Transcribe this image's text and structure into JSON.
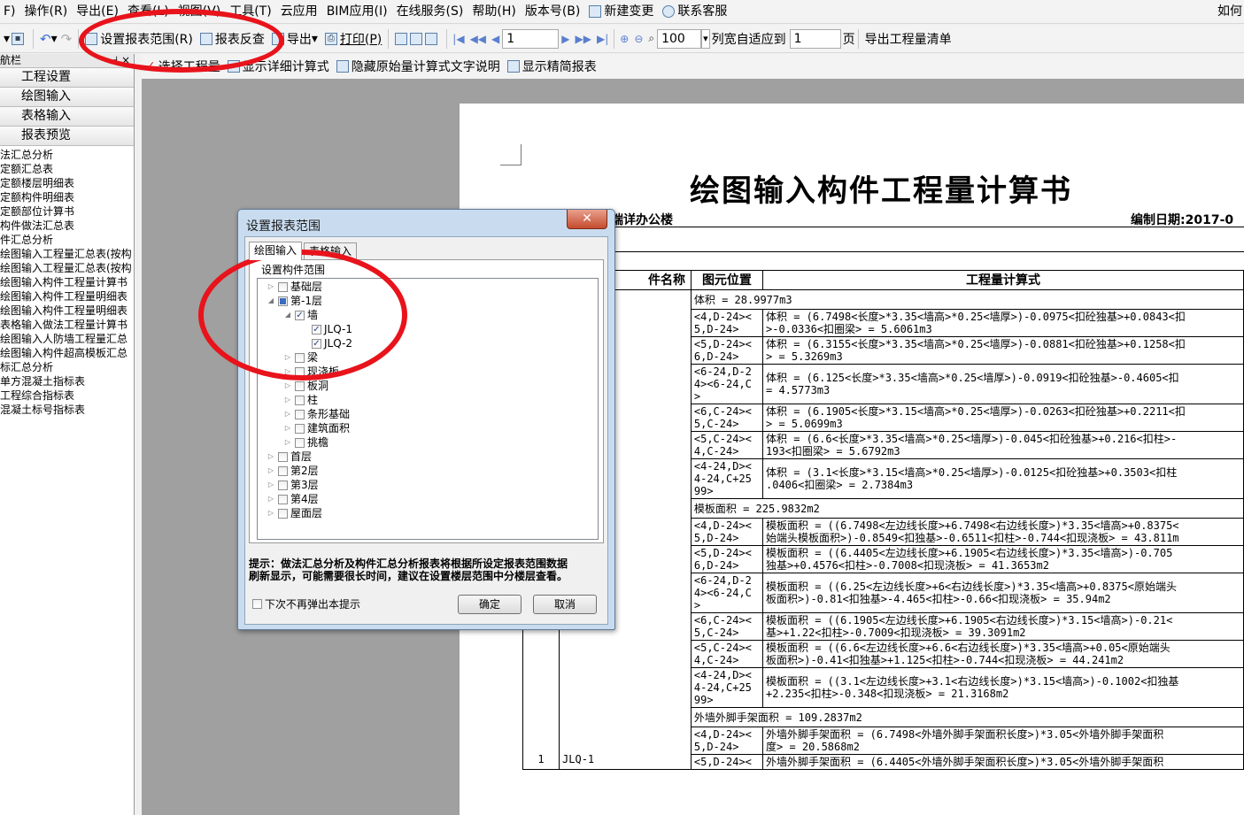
{
  "menubar": {
    "items": [
      "F)",
      "操作(R)",
      "导出(E)",
      "查看(L)",
      "视图(V)",
      "工具(T)",
      "云应用",
      "BIM应用(I)",
      "在线服务(S)",
      "帮助(H)",
      "版本号(B)",
      "新建变更",
      "联系客服"
    ],
    "right_text": "如何"
  },
  "toolbar1": {
    "set_range": "设置报表范围(R)",
    "report_check": "报表反查",
    "export": "导出",
    "print": "打印(P)",
    "page_value": "1",
    "zoom_value": "100",
    "fit_label": "列宽自适应到",
    "fit_value": "1",
    "page_unit": "页",
    "export_list": "导出工程量清单"
  },
  "toolbar2": {
    "select_project": "选择工程量",
    "show_detail": "显示详细计算式",
    "hide_desc": "隐藏原始量计算式文字说明",
    "show_fine": "显示精简报表"
  },
  "leftpanel": {
    "head_label": "航栏",
    "head_pin": "⊣ ×",
    "nav_buttons": [
      "工程设置",
      "绘图输入",
      "表格输入",
      "报表预览"
    ],
    "tree": [
      "法汇总分析",
      "定额汇总表",
      "定额楼层明细表",
      "定额构件明细表",
      "定额部位计算书",
      "构件做法汇总表",
      "件汇总分析",
      "绘图输入工程量汇总表(按构",
      "绘图输入工程量汇总表(按构",
      "绘图输入构件工程量计算书",
      "绘图输入构件工程量明细表",
      "绘图输入构件工程量明细表",
      "表格输入做法工程量计算书",
      "绘图输入人防墙工程量汇总",
      "绘图输入构件超高模板汇总",
      "标汇总分析",
      "单方混凝土指标表",
      "工程综合指标表",
      "混凝土标号指标表"
    ]
  },
  "report": {
    "title": "绘图输入构件工程量计算书",
    "project": "端详办公楼",
    "date_label": "编制日期:2017-0",
    "headers": [
      "件名称",
      "图元位置",
      "工程量计算式"
    ],
    "rows": [
      {
        "num": "",
        "name": "",
        "pos": "",
        "formula": "体积 = 28.9977m3",
        "span": true
      },
      {
        "num": "",
        "name": "",
        "pos": "<4,D-24><\n5,D-24>",
        "formula": "体积 = (6.7498<长度>*3.35<墙高>*0.25<墙厚>)-0.0975<扣砼独基>+0.0843<扣\n>-0.0336<扣圈梁> = 5.6061m3"
      },
      {
        "num": "",
        "name": "",
        "pos": "<5,D-24><\n6,D-24>",
        "formula": "体积 = (6.3155<长度>*3.35<墙高>*0.25<墙厚>)-0.0881<扣砼独基>+0.1258<扣\n> = 5.3269m3"
      },
      {
        "num": "",
        "name": "",
        "pos": "<6-24,D-2\n4><6-24,C\n>",
        "formula": "体积 = (6.125<长度>*3.35<墙高>*0.25<墙厚>)-0.0919<扣砼独基>-0.4605<扣\n = 4.5773m3"
      },
      {
        "num": "",
        "name": "",
        "pos": "<6,C-24><\n5,C-24>",
        "formula": "体积 = (6.1905<长度>*3.15<墙高>*0.25<墙厚>)-0.0263<扣砼独基>+0.2211<扣\n> = 5.0699m3"
      },
      {
        "num": "",
        "name": "",
        "pos": "<5,C-24><\n4,C-24>",
        "formula": "体积 = (6.6<长度>*3.35<墙高>*0.25<墙厚>)-0.045<扣砼独基>+0.216<扣柱>-\n193<扣圈梁> = 5.6792m3"
      },
      {
        "num": "",
        "name": "",
        "pos": "<4-24,D><\n4-24,C+25\n99>",
        "formula": "体积 = (3.1<长度>*3.15<墙高>*0.25<墙厚>)-0.0125<扣砼独基>+0.3503<扣柱\n.0406<扣圈梁> = 2.7384m3"
      },
      {
        "num": "",
        "name": "",
        "pos": "",
        "formula": "模板面积 = 225.9832m2",
        "span": true
      },
      {
        "num": "",
        "name": "",
        "pos": "<4,D-24><\n5,D-24>",
        "formula": "模板面积 = ((6.7498<左边线长度>+6.7498<右边线长度>)*3.35<墙高>+0.8375<\n始端头模板面积>)-0.8549<扣独基>-0.6511<扣柱>-0.744<扣现浇板> = 43.811m"
      },
      {
        "num": "",
        "name": "",
        "pos": "<5,D-24><\n6,D-24>",
        "formula": "模板面积 = ((6.4405<左边线长度>+6.1905<右边线长度>)*3.35<墙高>)-0.705\n独基>+0.4576<扣柱>-0.7008<扣现浇板> = 41.3653m2"
      },
      {
        "num": "",
        "name": "",
        "pos": "<6-24,D-2\n4><6-24,C\n>",
        "formula": "模板面积 = ((6.25<左边线长度>+6<右边线长度>)*3.35<墙高>+0.8375<原始端头\n板面积>)-0.81<扣独基>-4.465<扣柱>-0.66<扣现浇板> = 35.94m2"
      },
      {
        "num": "",
        "name": "",
        "pos": "<6,C-24><\n5,C-24>",
        "formula": "模板面积 = ((6.1905<左边线长度>+6.1905<右边线长度>)*3.15<墙高>)-0.21<\n基>+1.22<扣柱>-0.7009<扣现浇板> = 39.3091m2"
      },
      {
        "num": "",
        "name": "",
        "pos": "<5,C-24><\n4,C-24>",
        "formula": "模板面积 = ((6.6<左边线长度>+6.6<右边线长度>)*3.35<墙高>+0.05<原始端头\n板面积>)-0.41<扣独基>+1.125<扣柱>-0.744<扣现浇板> = 44.241m2"
      },
      {
        "num": "",
        "name": "",
        "pos": "<4-24,D><\n4-24,C+25\n99>",
        "formula": "模板面积 = ((3.1<左边线长度>+3.1<右边线长度>)*3.15<墙高>)-0.1002<扣独基\n+2.235<扣柱>-0.348<扣现浇板> = 21.3168m2"
      },
      {
        "num": "1",
        "name": "JLQ-1",
        "pos": "",
        "formula": "外墙外脚手架面积 = 109.2837m2",
        "span": true
      },
      {
        "num": "",
        "name": "",
        "pos": "<4,D-24><\n5,D-24>",
        "formula": "外墙外脚手架面积 = (6.7498<外墙外脚手架面积长度>)*3.05<外墙外脚手架面积\n度> = 20.5868m2"
      },
      {
        "num": "",
        "name": "",
        "pos": "<5,D-24><",
        "formula": "外墙外脚手架面积 = (6.4405<外墙外脚手架面积长度>)*3.05<外墙外脚手架面积"
      }
    ]
  },
  "dialog": {
    "title": "设置报表范围",
    "close": "✕",
    "tabs": [
      "绘图输入",
      "表格输入"
    ],
    "group_label": "设置构件范围",
    "tree": [
      {
        "label": "基础层",
        "level": 0,
        "expand": "▷",
        "check": "none"
      },
      {
        "label": "第-1层",
        "level": 0,
        "expand": "◢",
        "check": "partial"
      },
      {
        "label": "墙",
        "level": 1,
        "expand": "◢",
        "check": "checked"
      },
      {
        "label": "JLQ-1",
        "level": 2,
        "expand": "",
        "check": "checked"
      },
      {
        "label": "JLQ-2",
        "level": 2,
        "expand": "",
        "check": "checked"
      },
      {
        "label": "梁",
        "level": 1,
        "expand": "▷",
        "check": "none"
      },
      {
        "label": "现浇板",
        "level": 1,
        "expand": "▷",
        "check": "none"
      },
      {
        "label": "板洞",
        "level": 1,
        "expand": "▷",
        "check": "none"
      },
      {
        "label": "柱",
        "level": 1,
        "expand": "▷",
        "check": "none"
      },
      {
        "label": "条形基础",
        "level": 1,
        "expand": "▷",
        "check": "none"
      },
      {
        "label": "建筑面积",
        "level": 1,
        "expand": "▷",
        "check": "none"
      },
      {
        "label": "挑檐",
        "level": 1,
        "expand": "▷",
        "check": "none"
      },
      {
        "label": "首层",
        "level": 0,
        "expand": "▷",
        "check": "none"
      },
      {
        "label": "第2层",
        "level": 0,
        "expand": "▷",
        "check": "none"
      },
      {
        "label": "第3层",
        "level": 0,
        "expand": "▷",
        "check": "none"
      },
      {
        "label": "第4层",
        "level": 0,
        "expand": "▷",
        "check": "none"
      },
      {
        "label": "屋面层",
        "level": 0,
        "expand": "▷",
        "check": "none"
      }
    ],
    "hint": "提示：做法汇总分析及构件汇总分析报表将根据所设定报表范围数据\n刷新显示，可能需要很长时间，建议在设置楼层范围中分楼层查看。",
    "noshow_label": "下次不再弹出本提示",
    "ok": "确定",
    "cancel": "取消"
  },
  "colors": {
    "annotation": "#e8131b",
    "paper": "#ffffff",
    "workspace": "#a0a0a0"
  }
}
